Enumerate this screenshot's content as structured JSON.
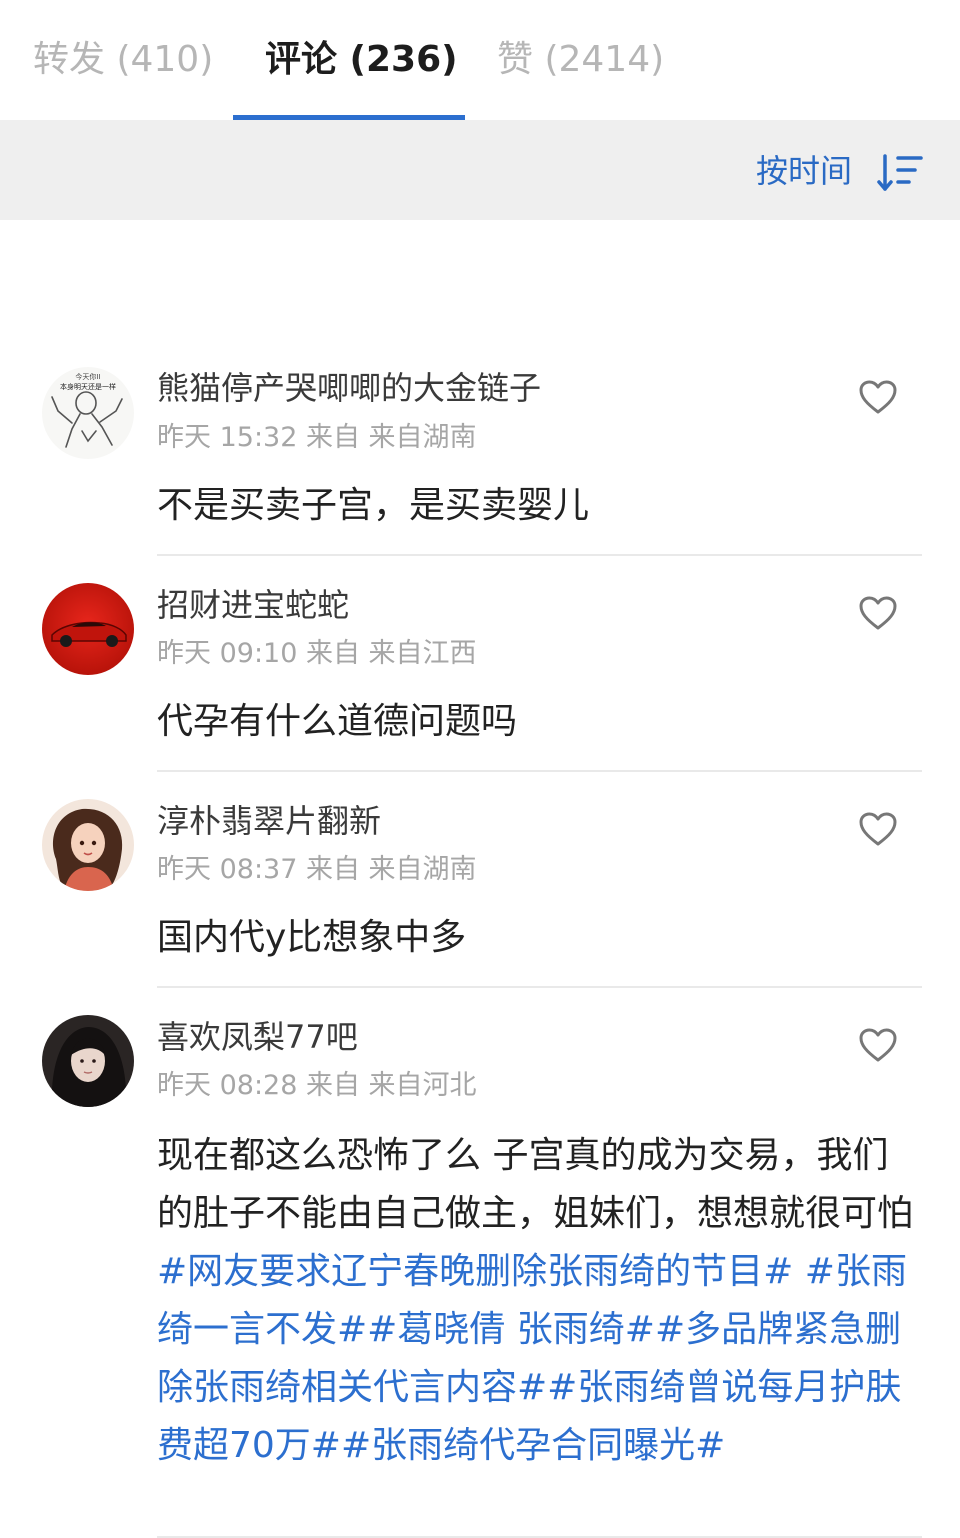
{
  "tabs": [
    {
      "label": "转发 (410)"
    },
    {
      "label": "评论 (236)"
    },
    {
      "label": "赞 (2414)"
    }
  ],
  "sort": {
    "label": "按时间",
    "icon": "sort-descending-icon"
  },
  "colors": {
    "accent": "#2c6fcf",
    "sort_bar": "#efefef"
  },
  "comments": [
    {
      "username": "熊猫停产哭唧唧的大金链子",
      "meta": "昨天 15:32 来自 来自湖南",
      "text": "不是买卖子宫，是买卖婴儿",
      "avatar_text_1": "今天你II",
      "avatar_text_2": "本身明天还是一样"
    },
    {
      "username": "招财进宝蛇蛇",
      "meta": "昨天 09:10 来自 来自江西",
      "text": "代孕有什么道德问题吗"
    },
    {
      "username": "淳朴翡翠片翻新",
      "meta": "昨天 08:37 来自 来自湖南",
      "text": "国内代y比想象中多"
    },
    {
      "username": "喜欢凤梨77吧",
      "meta": "昨天 08:28 来自 来自河北",
      "text_plain": "现在都这么恐怖了么 子宫真的成为交易，我们的肚子不能由自己做主，姐妹们，想想就很可怕",
      "hashtags": [
        "#网友要求辽宁春晚删除张雨绮的节目#",
        " ",
        "#张雨绮一言不发#",
        "#葛晓倩 张雨绮#",
        "#多品牌紧急删除张雨绮相关代言内容#",
        "#张雨绮曾说每月护肤费超70万#",
        "#张雨绮代孕合同曝光#"
      ]
    }
  ]
}
